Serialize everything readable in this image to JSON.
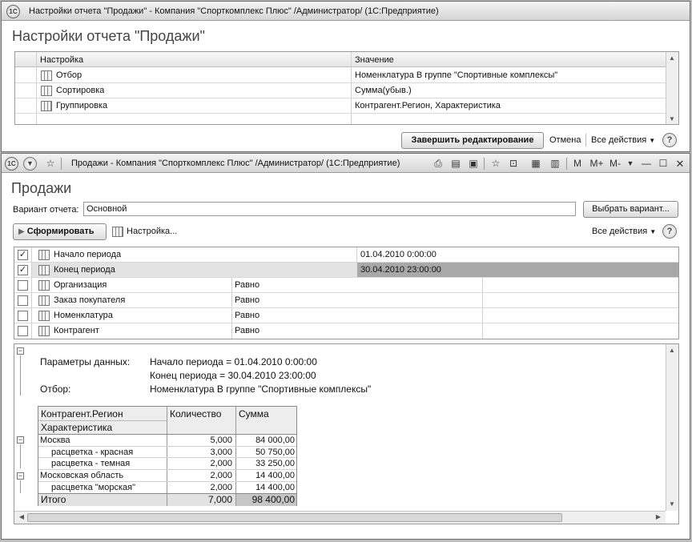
{
  "window1": {
    "title": "Настройки отчета \"Продажи\" - Компания \"Спорткомплекс Плюс\" /Администратор/  (1С:Предприятие)",
    "logo": "1С",
    "heading": "Настройки отчета \"Продажи\"",
    "table": {
      "columns": [
        "Настройка",
        "Значение"
      ],
      "rows": [
        {
          "icon": "filter-icon",
          "name": "Отбор",
          "value": "Номенклатура В группе \"Спортивные комплексы\""
        },
        {
          "icon": "sort-icon",
          "name": "Сортировка",
          "value": "Сумма(убыв.)"
        },
        {
          "icon": "grouping-icon",
          "name": "Группировка",
          "value": "Контрагент.Регион, Характеристика"
        }
      ]
    },
    "footer": {
      "finish_button": "Завершить редактирование",
      "cancel_button": "Отмена",
      "all_actions": "Все действия",
      "help": "?"
    }
  },
  "window2": {
    "title": "Продажи - Компания \"Спорткомплекс Плюс\" /Администратор/  (1С:Предприятие)",
    "logo": "1С",
    "toolbar_icons": [
      "print-icon",
      "preview-icon",
      "save-icon",
      "favorites-icon",
      "history-icon",
      "calculator-icon",
      "calendar-icon"
    ],
    "memory_buttons": [
      "M",
      "M+",
      "M-"
    ],
    "heading": "Продажи",
    "variant_label": "Вариант отчета:",
    "variant_value": "Основной",
    "choose_variant_button": "Выбрать вариант...",
    "generate_button": "Сформировать",
    "settings_button": "Настройка...",
    "all_actions": "Все действия",
    "help": "?",
    "params": [
      {
        "checked": true,
        "name": "Начало периода",
        "condition": "",
        "value": "01.04.2010 0:00:00"
      },
      {
        "checked": true,
        "name": "Конец периода",
        "condition": "",
        "value": "30.04.2010 23:00:00"
      },
      {
        "checked": false,
        "name": "Организация",
        "condition": "Равно",
        "value": ""
      },
      {
        "checked": false,
        "name": "Заказ покупателя",
        "condition": "Равно",
        "value": ""
      },
      {
        "checked": false,
        "name": "Номенклатура",
        "condition": "Равно",
        "value": ""
      },
      {
        "checked": false,
        "name": "Контрагент",
        "condition": "Равно",
        "value": ""
      }
    ],
    "report": {
      "params_label": "Параметры данных:",
      "param_line1": "Начало периода = 01.04.2010 0:00:00",
      "param_line2": "Конец периода = 30.04.2010 23:00:00",
      "filter_label": "Отбор:",
      "filter_value": "Номенклатура В группе \"Спортивные комплексы\"",
      "header": {
        "col1_line1": "Контрагент.Регион",
        "col1_line2": "Характеристика",
        "col2": "Количество",
        "col3": "Сумма"
      },
      "rows": [
        {
          "label": "Москва",
          "qty": "5,000",
          "sum": "84 000,00",
          "level": 0
        },
        {
          "label": "расцветка - красная",
          "qty": "3,000",
          "sum": "50 750,00",
          "level": 1
        },
        {
          "label": "расцветка - темная",
          "qty": "2,000",
          "sum": "33 250,00",
          "level": 1
        },
        {
          "label": "Московская область",
          "qty": "2,000",
          "sum": "14 400,00",
          "level": 0
        },
        {
          "label": "расцветка \"морская\"",
          "qty": "2,000",
          "sum": "14 400,00",
          "level": 1
        }
      ],
      "total": {
        "label": "Итого",
        "qty": "7,000",
        "sum": "98 400,00"
      }
    }
  }
}
